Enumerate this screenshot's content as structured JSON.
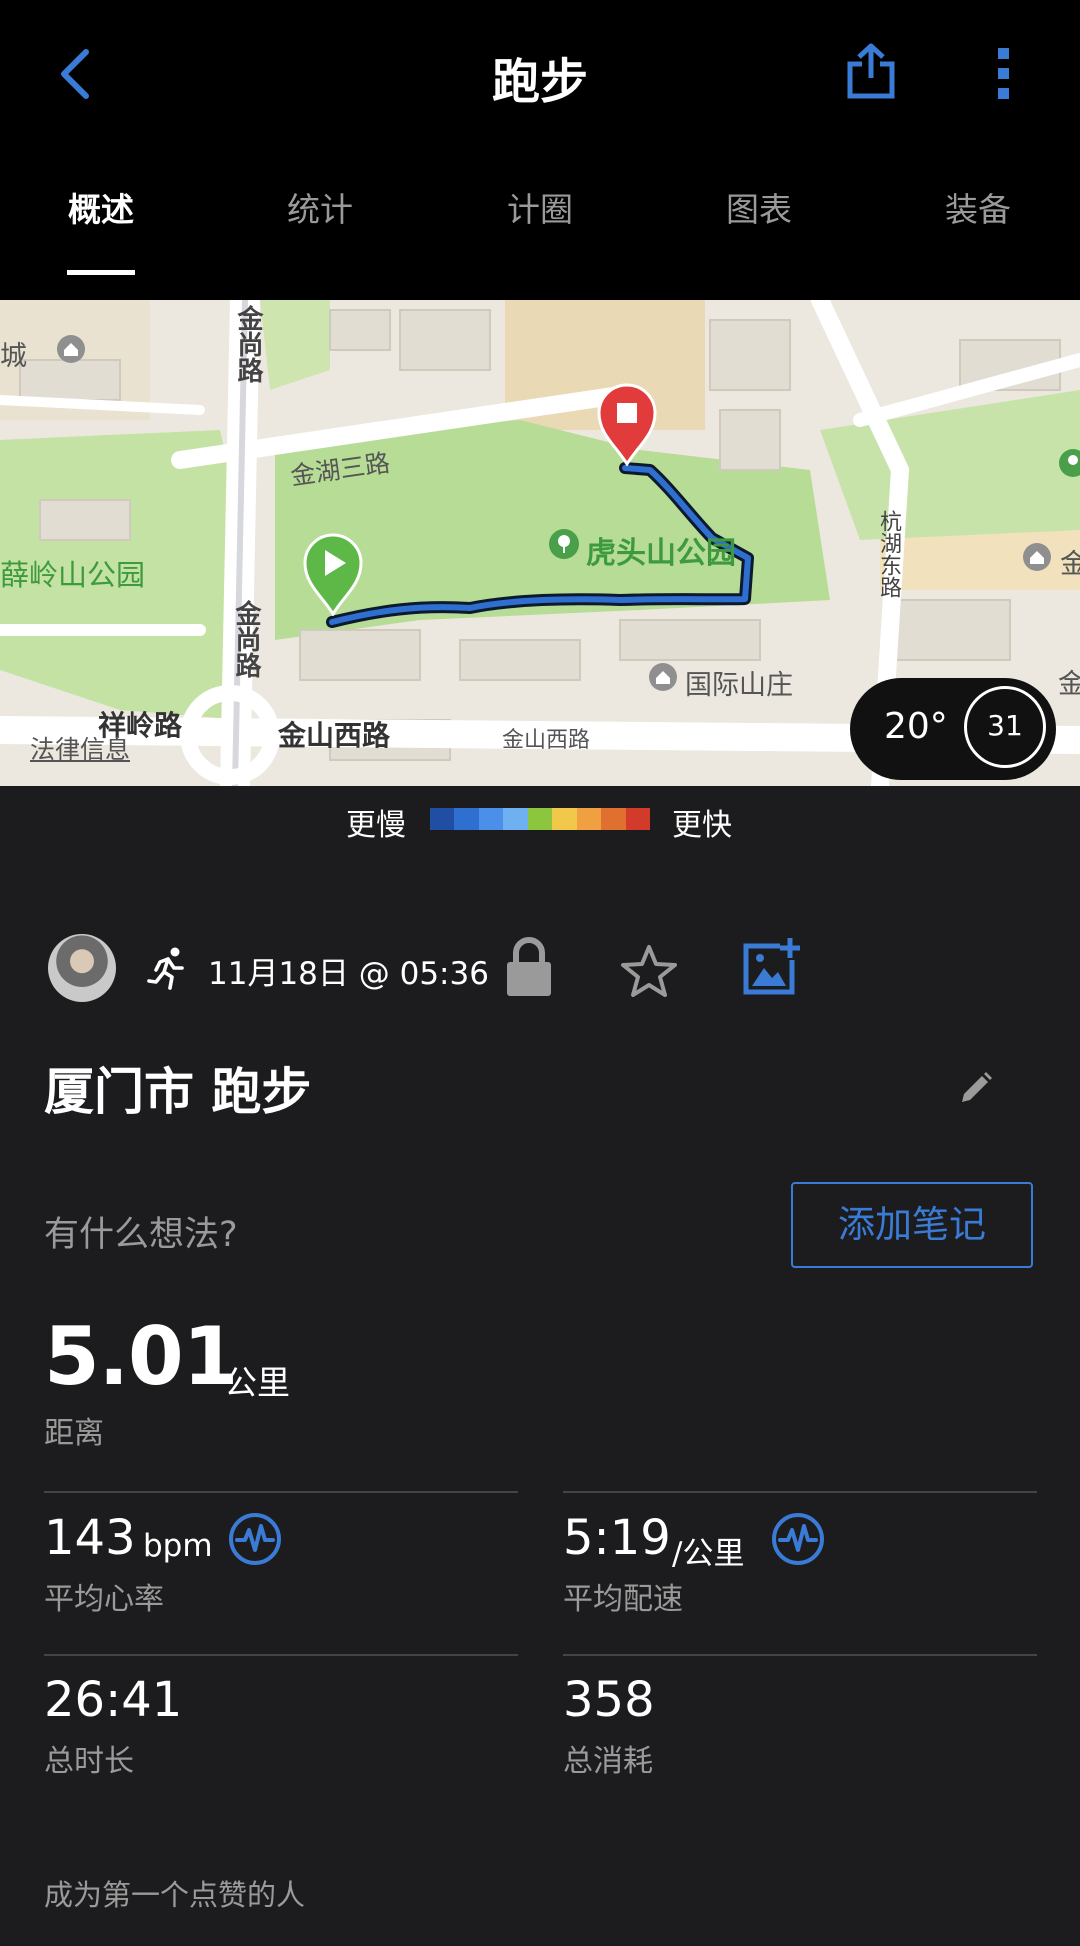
{
  "header": {
    "title": "跑步",
    "tabs": [
      {
        "label": "概述",
        "active": true
      },
      {
        "label": "统计",
        "active": false
      },
      {
        "label": "计圈",
        "active": false
      },
      {
        "label": "图表",
        "active": false
      },
      {
        "label": "装备",
        "active": false
      }
    ]
  },
  "map": {
    "labels": {
      "jinshang_road_top": "金尚路",
      "jinshang_road_bottom": "金尚路",
      "jinhu_3rd_road": "金湖三路",
      "huyi_park": "虎头山公园",
      "xueling_park": "薛岭山公园",
      "hangzhou_east_road": "杭湖东路",
      "guoji_shanzhuang": "国际山庄",
      "xiangling_road": "祥岭路",
      "jinshan_west_road_bold": "金山西路",
      "jinshan_west_road": "金山西路",
      "legal_info": "法律信息",
      "edge_city": "城",
      "edge_jin_1": "金",
      "edge_jin_2": "金"
    },
    "weather": {
      "temperature": "20°",
      "gauge_value": "31"
    },
    "speed_legend": {
      "slow_label": "更慢",
      "fast_label": "更快",
      "colors": [
        "#1f4ea3",
        "#2f6fd0",
        "#4b8fe8",
        "#6fb0f0",
        "#8cc63f",
        "#f1c84a",
        "#f0a040",
        "#e07030",
        "#d23a2a"
      ]
    }
  },
  "activity": {
    "date_time": "11月18日 @ 05:36",
    "name": "厦门市 跑步",
    "notes_prompt": "有什么想法?",
    "add_note_button": "添加笔记",
    "distance": {
      "value": "5.01",
      "unit": "公里",
      "label": "距离"
    },
    "stats": {
      "heart_rate": {
        "value": "143",
        "unit": "bpm",
        "label": "平均心率"
      },
      "pace": {
        "value": "5:19",
        "unit": "/公里",
        "label": "平均配速"
      },
      "duration": {
        "value": "26:41",
        "label": "总时长"
      },
      "calories": {
        "value": "358",
        "label": "总消耗"
      }
    },
    "likes_text": "成为第一个点赞的人"
  },
  "colors": {
    "accent": "#3a7bd5",
    "route": "#1f4ea3",
    "start_pin": "#5db848",
    "end_pin": "#e23b3b"
  }
}
